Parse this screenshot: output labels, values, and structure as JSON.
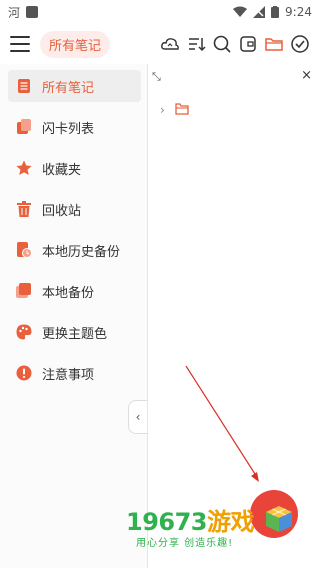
{
  "status_bar": {
    "time": "9:24"
  },
  "header": {
    "title": "所有笔记"
  },
  "toolbar_icons": [
    "cloud-sync-icon",
    "sort-icon",
    "search-icon",
    "card-icon",
    "folder-icon",
    "check-circle-icon"
  ],
  "sidebar": {
    "items": [
      {
        "label": "所有笔记",
        "icon": "notes-icon",
        "active": true
      },
      {
        "label": "闪卡列表",
        "icon": "flashcards-icon",
        "active": false
      },
      {
        "label": "收藏夹",
        "icon": "star-icon",
        "active": false
      },
      {
        "label": "回收站",
        "icon": "trash-icon",
        "active": false
      },
      {
        "label": "本地历史备份",
        "icon": "history-backup-icon",
        "active": false
      },
      {
        "label": "本地备份",
        "icon": "backup-icon",
        "active": false
      },
      {
        "label": "更换主题色",
        "icon": "palette-icon",
        "active": false
      },
      {
        "label": "注意事项",
        "icon": "alert-icon",
        "active": false
      }
    ],
    "collapse_glyph": "‹"
  },
  "main": {
    "shrink_glyph": "⤡",
    "close_glyph": "×"
  },
  "watermark": {
    "brand_digits": "19673",
    "brand_word": "游戏",
    "slogan": "用心分享 创造乐趣!"
  },
  "colors": {
    "accent": "#e8603c",
    "active_bg": "#eeeeee",
    "sidebar_bg": "#fbfbfb"
  }
}
